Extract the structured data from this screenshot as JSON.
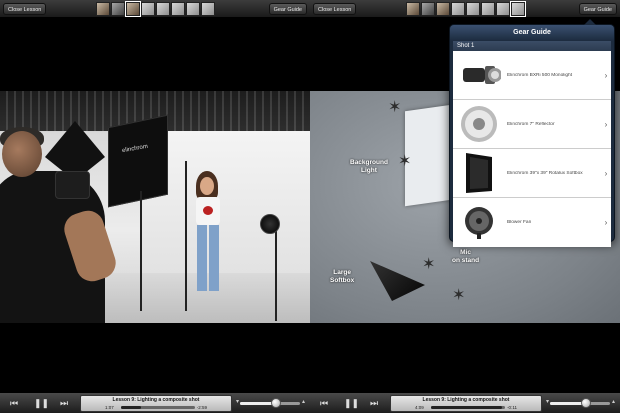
{
  "left": {
    "topbar": {
      "close_label": "Close Lesson",
      "gear_label": "Gear Guide"
    },
    "player": {
      "lesson": "Lesson 9: Lighting a composite shot",
      "elapsed": "1:07",
      "remaining": "-2:59",
      "progress": 0.27,
      "volume": 0.6
    }
  },
  "right": {
    "topbar": {
      "close_label": "Close Lesson",
      "gear_label": "Gear Guide"
    },
    "diagram_labels": {
      "background_light": "Background\nLight",
      "mic_on_stand": "Mic\non stand",
      "large_softbox": "Large\nSoftbox"
    },
    "popover": {
      "title": "Gear Guide",
      "section": "Shot 1",
      "items": [
        {
          "name": "Elinchrom BXRi 500 Monolight",
          "icon": "monolight-icon"
        },
        {
          "name": "Elinchrom 7\" Reflector",
          "icon": "reflector-icon"
        },
        {
          "name": "Elinchrom 39\"x 39\" Rotalux Softbox",
          "icon": "softbox-icon"
        },
        {
          "name": "Blower Fan",
          "icon": "fan-icon"
        }
      ]
    },
    "player": {
      "lesson": "Lesson 9: Lighting a composite shot",
      "elapsed": "4:09",
      "remaining": "-0:11",
      "progress": 0.96,
      "volume": 0.6
    }
  },
  "photo_label": "elinchrom",
  "colors": {
    "popover_bg": "#1c2b3e",
    "bar_dark": "#1a1a1a"
  }
}
